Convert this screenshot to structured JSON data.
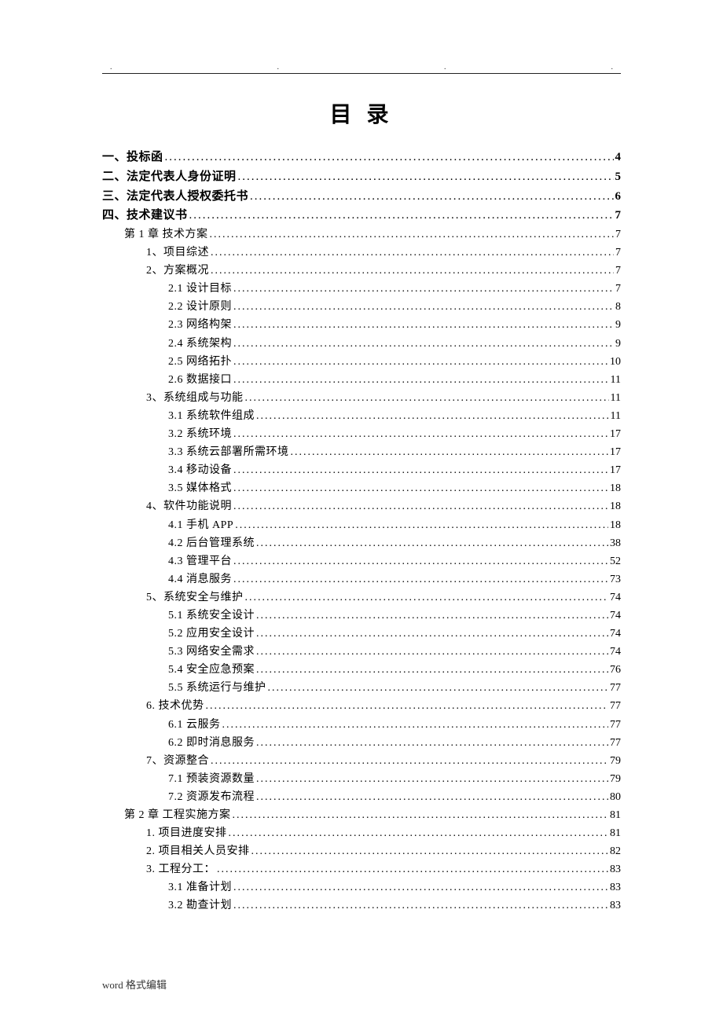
{
  "header_dots": [
    ".",
    ".",
    ".",
    "."
  ],
  "title": "目 录",
  "footer": "word 格式编辑",
  "toc": [
    {
      "level": 0,
      "label": "一、投标函",
      "page": "4"
    },
    {
      "level": 0,
      "label": "二、法定代表人身份证明",
      "page": "5"
    },
    {
      "level": 0,
      "label": "三、法定代表人授权委托书",
      "page": "6"
    },
    {
      "level": 0,
      "label": "四、技术建议书",
      "page": "7"
    },
    {
      "level": 1,
      "label": "第 1 章 技术方案",
      "page": "7"
    },
    {
      "level": 2,
      "label": "1、项目综述",
      "page": "7"
    },
    {
      "level": 2,
      "label": "2、方案概况",
      "page": "7"
    },
    {
      "level": 3,
      "label": "2.1 设计目标",
      "page": "7"
    },
    {
      "level": 3,
      "label": "2.2 设计原则",
      "page": "8"
    },
    {
      "level": 3,
      "label": "2.3 网络构架",
      "page": "9"
    },
    {
      "level": 3,
      "label": "2.4 系统架构",
      "page": "9"
    },
    {
      "level": 3,
      "label": "2.5 网络拓扑",
      "page": "10"
    },
    {
      "level": 3,
      "label": "2.6 数据接口",
      "page": "11"
    },
    {
      "level": 2,
      "label": "3、系统组成与功能",
      "page": "11"
    },
    {
      "level": 3,
      "label": "3.1 系统软件组成",
      "page": "11"
    },
    {
      "level": 3,
      "label": "3.2 系统环境",
      "page": "17"
    },
    {
      "level": 3,
      "label": "3.3 系统云部署所需环境",
      "page": "17"
    },
    {
      "level": 3,
      "label": "3.4 移动设备",
      "page": "17"
    },
    {
      "level": 3,
      "label": "3.5 媒体格式",
      "page": "18"
    },
    {
      "level": 2,
      "label": "4、软件功能说明",
      "page": "18"
    },
    {
      "level": 3,
      "label": "4.1 手机 APP",
      "page": "18"
    },
    {
      "level": 3,
      "label": "4.2 后台管理系统",
      "page": "38"
    },
    {
      "level": 3,
      "label": "4.3 管理平台",
      "page": "52"
    },
    {
      "level": 3,
      "label": "4.4 消息服务",
      "page": "73"
    },
    {
      "level": 2,
      "label": "5、系统安全与维护",
      "page": "74"
    },
    {
      "level": 3,
      "label": "5.1 系统安全设计",
      "page": "74"
    },
    {
      "level": 3,
      "label": "5.2 应用安全设计",
      "page": "74"
    },
    {
      "level": 3,
      "label": "5.3 网络安全需求",
      "page": "74"
    },
    {
      "level": 3,
      "label": "5.4 安全应急预案",
      "page": "76"
    },
    {
      "level": 3,
      "label": "5.5 系统运行与维护",
      "page": "77"
    },
    {
      "level": 2,
      "label": "6. 技术优势",
      "page": "77"
    },
    {
      "level": 3,
      "label": "6.1 云服务",
      "page": "77"
    },
    {
      "level": 3,
      "label": "6.2 即时消息服务",
      "page": "77"
    },
    {
      "level": 2,
      "label": "7、资源整合",
      "page": "79"
    },
    {
      "level": 3,
      "label": "7.1 预装资源数量",
      "page": "79"
    },
    {
      "level": 3,
      "label": "7.2 资源发布流程",
      "page": "80"
    },
    {
      "level": 1,
      "label": "第 2 章 工程实施方案",
      "page": "81"
    },
    {
      "level": 2,
      "label": "1. 项目进度安排",
      "page": "81"
    },
    {
      "level": 2,
      "label": "2. 项目相关人员安排",
      "page": "82"
    },
    {
      "level": 2,
      "label": "3. 工程分工：",
      "page": "83"
    },
    {
      "level": 3,
      "label": "3.1 准备计划",
      "page": "83"
    },
    {
      "level": 3,
      "label": "3.2 勘查计划",
      "page": "83"
    }
  ]
}
